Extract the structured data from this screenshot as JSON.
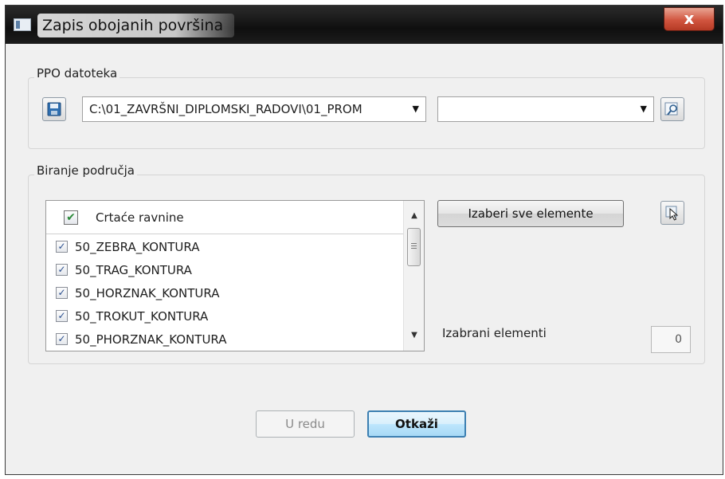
{
  "window": {
    "title": "Zapis obojanih površina",
    "close_label": "x"
  },
  "ppo": {
    "group_label": "PPO datoteka",
    "path_value": "C:\\01_ZAVRŠNI_DIPLOMSKI_RADOVI\\01_PROM",
    "second_value": ""
  },
  "area": {
    "group_label": "Biranje područja",
    "list_header": "Crtaće ravnine",
    "items": [
      {
        "label": "50_ZEBRA_KONTURA",
        "checked": true
      },
      {
        "label": "50_TRAG_KONTURA",
        "checked": true
      },
      {
        "label": "50_HORZNAK_KONTURA",
        "checked": true
      },
      {
        "label": "50_TROKUT_KONTURA",
        "checked": true
      },
      {
        "label": "50_PHORZNAK_KONTURA",
        "checked": true
      }
    ],
    "select_all_label": "Izaberi sve elemente",
    "selected_label": "Izabrani elementi",
    "selected_count": "0"
  },
  "buttons": {
    "ok_label": "U redu",
    "cancel_label": "Otkaži"
  },
  "colors": {
    "window_bg": "#f0f0f0",
    "default_button_border": "#3c7fb1",
    "checkbox_mark": "#2b4f8f"
  },
  "icons": [
    "window-icon",
    "save-disk-icon",
    "browse-search-icon",
    "select-pointer-icon"
  ]
}
